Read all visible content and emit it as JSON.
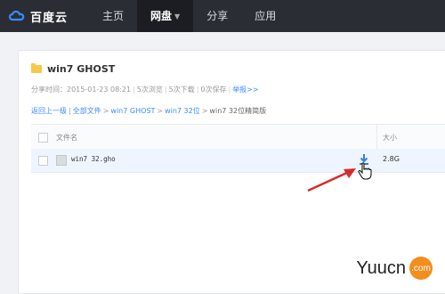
{
  "header": {
    "logo_text": "百度云",
    "nav": [
      "主页",
      "网盘",
      "分享",
      "应用"
    ],
    "active_index": 1
  },
  "share": {
    "title": "win7 GHOST",
    "meta": {
      "share_time": "分享时间：2015-01-23 08:21",
      "views": "5次浏览",
      "downloads": "5次下载",
      "saves": "0次保存",
      "report": "举报>>"
    },
    "breadcrumb": {
      "back": "返回上一级",
      "all_files": "全部文件",
      "path": [
        "win7 GHOST",
        "win7 32位"
      ],
      "current": "win7 32位精简版"
    },
    "table": {
      "col_name": "文件名",
      "col_size": "大小",
      "files": [
        {
          "name": "win7 32.gho",
          "size": "2.8G"
        }
      ]
    }
  },
  "watermark": {
    "text": "Yuucn",
    "badge": ".com"
  }
}
